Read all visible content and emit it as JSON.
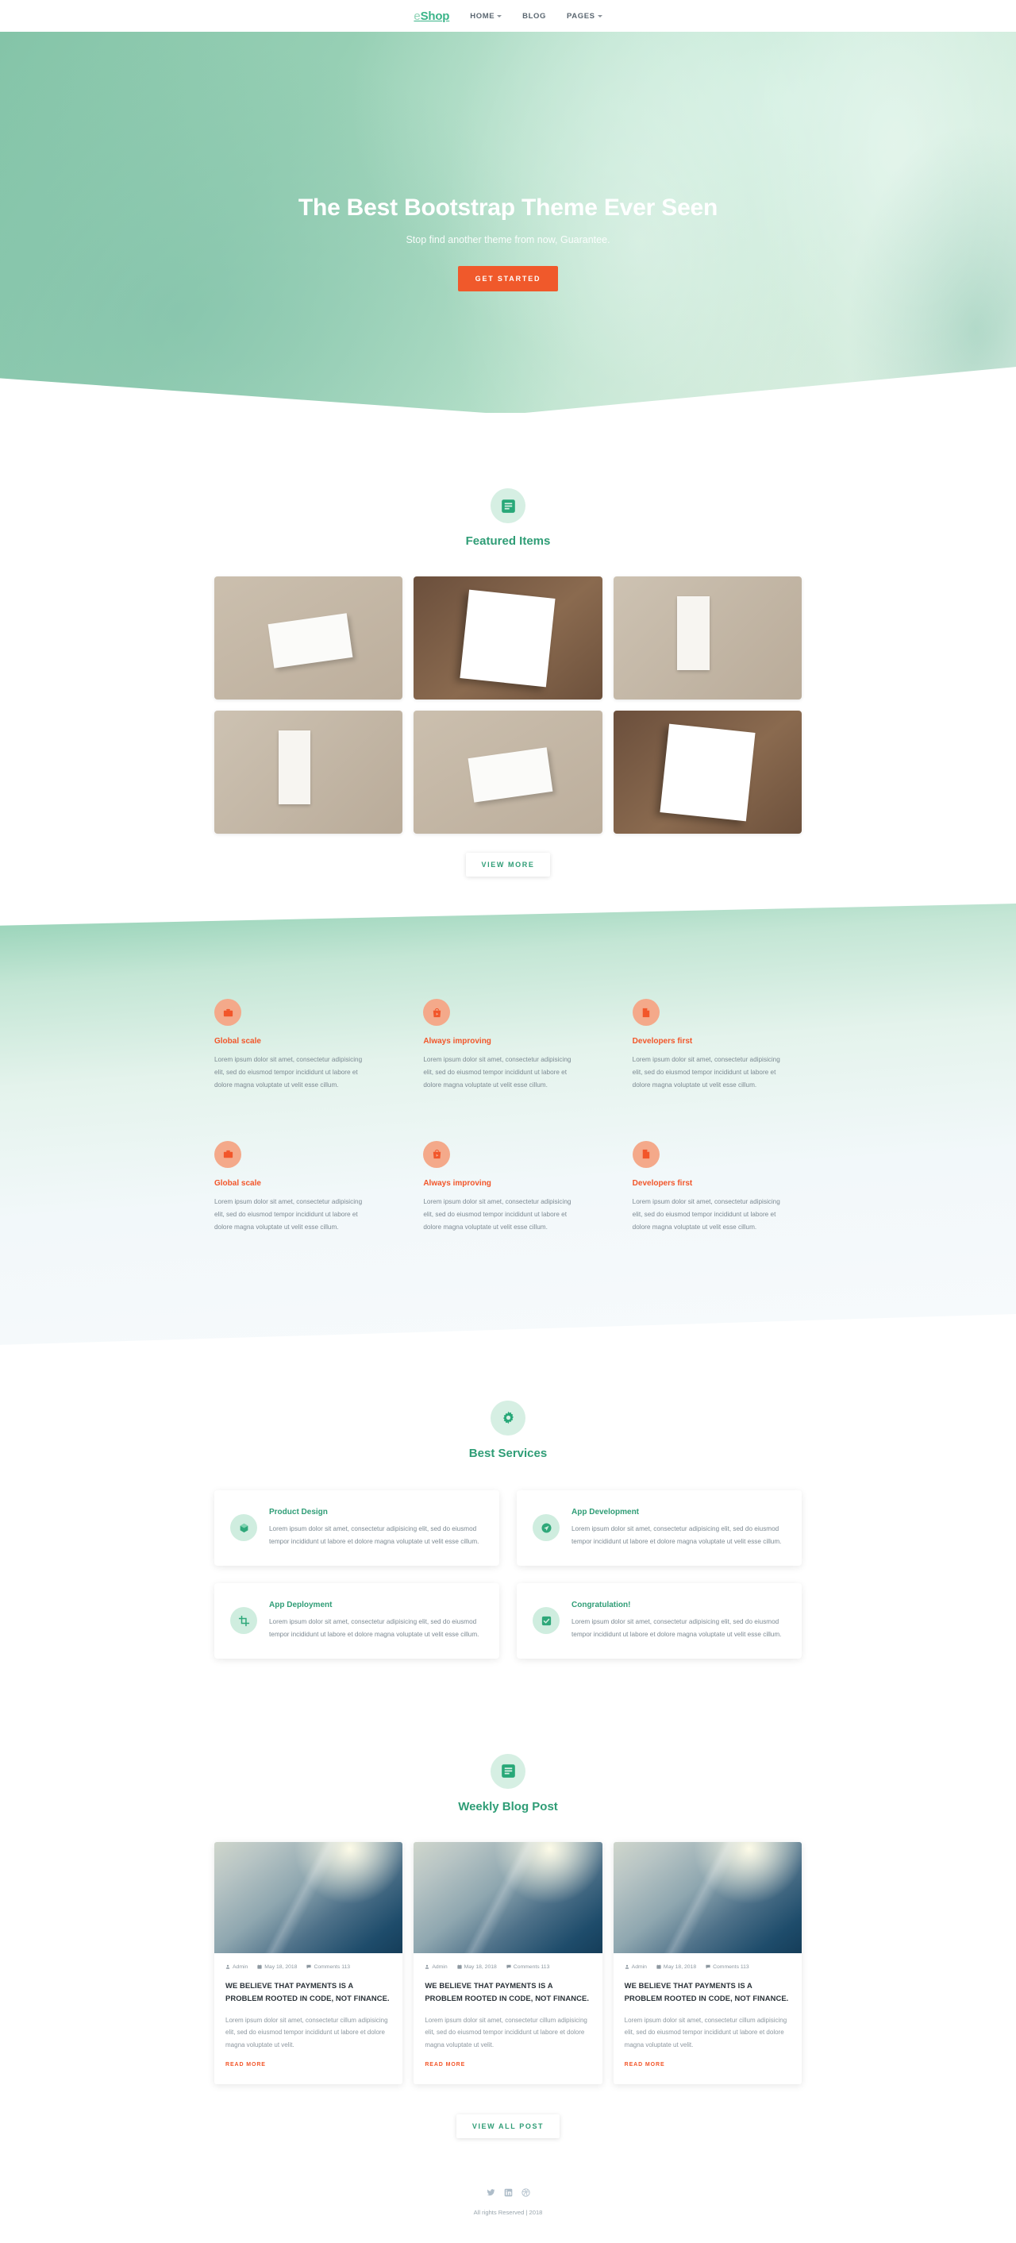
{
  "nav": {
    "brand_prefix": "e",
    "brand_main": "Shop",
    "links": [
      {
        "label": "HOME",
        "has_caret": true
      },
      {
        "label": "BLOG",
        "has_caret": false
      },
      {
        "label": "PAGES",
        "has_caret": true
      }
    ]
  },
  "hero": {
    "title": "The Best Bootstrap Theme Ever Seen",
    "subtitle": "Stop find another theme from now, Guarantee.",
    "cta_label": "GET STARTED"
  },
  "featured": {
    "icon": "document-lines-icon",
    "title": "Featured Items",
    "items": [
      {
        "name": "business-card-stack-beige"
      },
      {
        "name": "business-card-fan-brown"
      },
      {
        "name": "stationery-kit-flatlay"
      },
      {
        "name": "stationery-kit-flatlay"
      },
      {
        "name": "business-card-stack-beige"
      },
      {
        "name": "business-card-fan-brown"
      }
    ],
    "view_more_label": "VIEW MORE"
  },
  "features": [
    {
      "icon": "briefcase-icon",
      "title": "Global scale",
      "text": "Lorem ipsum dolor sit amet, consectetur adipisicing elit, sed do eiusmod tempor incididunt ut labore et dolore magna voluptate ut velit esse cillum."
    },
    {
      "icon": "shopping-bag-play-icon",
      "title": "Always improving",
      "text": "Lorem ipsum dolor sit amet, consectetur adipisicing elit, sed do eiusmod tempor incididunt ut labore et dolore magna voluptate ut velit esse cillum."
    },
    {
      "icon": "file-document-icon",
      "title": "Developers first",
      "text": "Lorem ipsum dolor sit amet, consectetur adipisicing elit, sed do eiusmod tempor incididunt ut labore et dolore magna voluptate ut velit esse cillum."
    },
    {
      "icon": "briefcase-icon",
      "title": "Global scale",
      "text": "Lorem ipsum dolor sit amet, consectetur adipisicing elit, sed do eiusmod tempor incididunt ut labore et dolore magna voluptate ut velit esse cillum."
    },
    {
      "icon": "shopping-bag-play-icon",
      "title": "Always improving",
      "text": "Lorem ipsum dolor sit amet, consectetur adipisicing elit, sed do eiusmod tempor incididunt ut labore et dolore magna voluptate ut velit esse cillum."
    },
    {
      "icon": "file-document-icon",
      "title": "Developers first",
      "text": "Lorem ipsum dolor sit amet, consectetur adipisicing elit, sed do eiusmod tempor incididunt ut labore et dolore magna voluptate ut velit esse cillum."
    }
  ],
  "services": {
    "icon": "gear-icon",
    "title": "Best Services",
    "cards": [
      {
        "icon": "cube-icon",
        "title": "Product Design",
        "text": "Lorem ipsum dolor sit amet, consectetur adipisicing elit, sed do eiusmod tempor incididunt ut labore et dolore magna voluptate ut velit esse cillum."
      },
      {
        "icon": "paper-plane-icon",
        "title": "App Development",
        "text": "Lorem ipsum dolor sit amet, consectetur adipisicing elit, sed do eiusmod tempor incididunt ut labore et dolore magna voluptate ut velit esse cillum."
      },
      {
        "icon": "crop-icon",
        "title": "App Deployment",
        "text": "Lorem ipsum dolor sit amet, consectetur adipisicing elit, sed do eiusmod tempor incididunt ut labore et dolore magna voluptate ut velit esse cillum."
      },
      {
        "icon": "check-square-icon",
        "title": "Congratulation!",
        "text": "Lorem ipsum dolor sit amet, consectetur adipisicing elit, sed do eiusmod tempor incididunt ut labore et dolore magna voluptate ut velit esse cillum."
      }
    ]
  },
  "blog": {
    "icon": "document-lines-icon",
    "title": "Weekly Blog Post",
    "posts": [
      {
        "author": "Admin",
        "date": "May 18, 2018",
        "comments": "Comments 113",
        "title": "WE BELIEVE THAT PAYMENTS IS A PROBLEM ROOTED IN CODE, NOT FINANCE.",
        "excerpt": "Lorem ipsum dolor sit amet, consectetur cillum adipisicing elit, sed do eiusmod tempor incididunt ut labore et dolore magna voluptate ut velit.",
        "read_more": "READ MORE"
      },
      {
        "author": "Admin",
        "date": "May 18, 2018",
        "comments": "Comments 113",
        "title": "WE BELIEVE THAT PAYMENTS IS A PROBLEM ROOTED IN CODE, NOT FINANCE.",
        "excerpt": "Lorem ipsum dolor sit amet, consectetur cillum adipisicing elit, sed do eiusmod tempor incididunt ut labore et dolore magna voluptate ut velit.",
        "read_more": "READ MORE"
      },
      {
        "author": "Admin",
        "date": "May 18, 2018",
        "comments": "Comments 113",
        "title": "WE BELIEVE THAT PAYMENTS IS A PROBLEM ROOTED IN CODE, NOT FINANCE.",
        "excerpt": "Lorem ipsum dolor sit amet, consectetur cillum adipisicing elit, sed do eiusmod tempor incididunt ut labore et dolore magna voluptate ut velit.",
        "read_more": "READ MORE"
      }
    ],
    "view_all_label": "VIEW ALL POST"
  },
  "footer": {
    "socials": [
      {
        "name": "twitter-icon"
      },
      {
        "name": "linkedin-icon"
      },
      {
        "name": "dribbble-icon"
      }
    ],
    "copyright": "All rights Reserved | 2018"
  },
  "colors": {
    "brand_green": "#2f9d76",
    "accent_orange": "#f2562a",
    "hero_green": "#8ecfb2"
  }
}
